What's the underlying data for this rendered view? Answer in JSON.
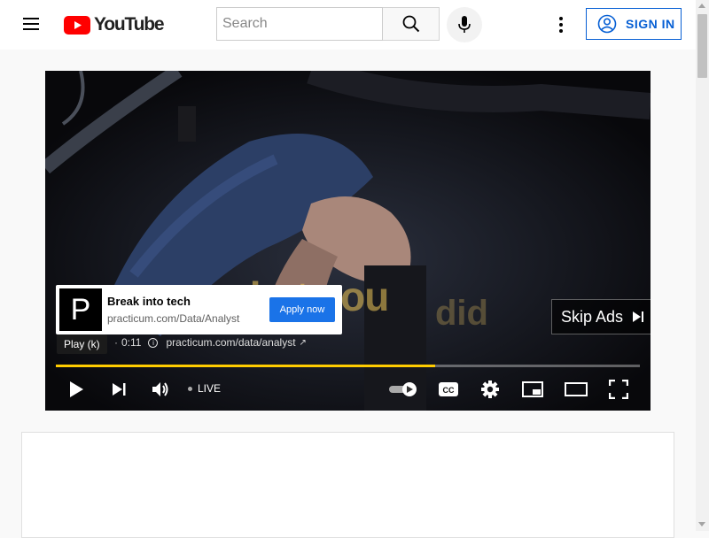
{
  "header": {
    "logo_text": "YouTube",
    "search_placeholder": "Search",
    "signin_label": "SIGN IN",
    "brand_red": "#ff0000",
    "accent_blue": "#065fd4"
  },
  "player": {
    "overlay_caption_1": "what you",
    "overlay_caption_2": "did",
    "ad": {
      "logo_letter": "P",
      "title": "Break into tech",
      "domain": "practicum.com/Data/Analyst",
      "cta_label": "Apply now"
    },
    "skip_label": "Skip Ads",
    "tooltip": "Play (k)",
    "ad_time": "0:11",
    "ad_link": "practicum.com/data/analyst",
    "progress": 0.65,
    "progress_color": "#ffcc00",
    "live_label": "LIVE",
    "icons": [
      "play-icon",
      "next-icon",
      "volume-icon",
      "autoplay-toggle-icon",
      "captions-icon",
      "settings-icon",
      "miniplayer-icon",
      "theater-icon",
      "fullscreen-icon"
    ]
  }
}
